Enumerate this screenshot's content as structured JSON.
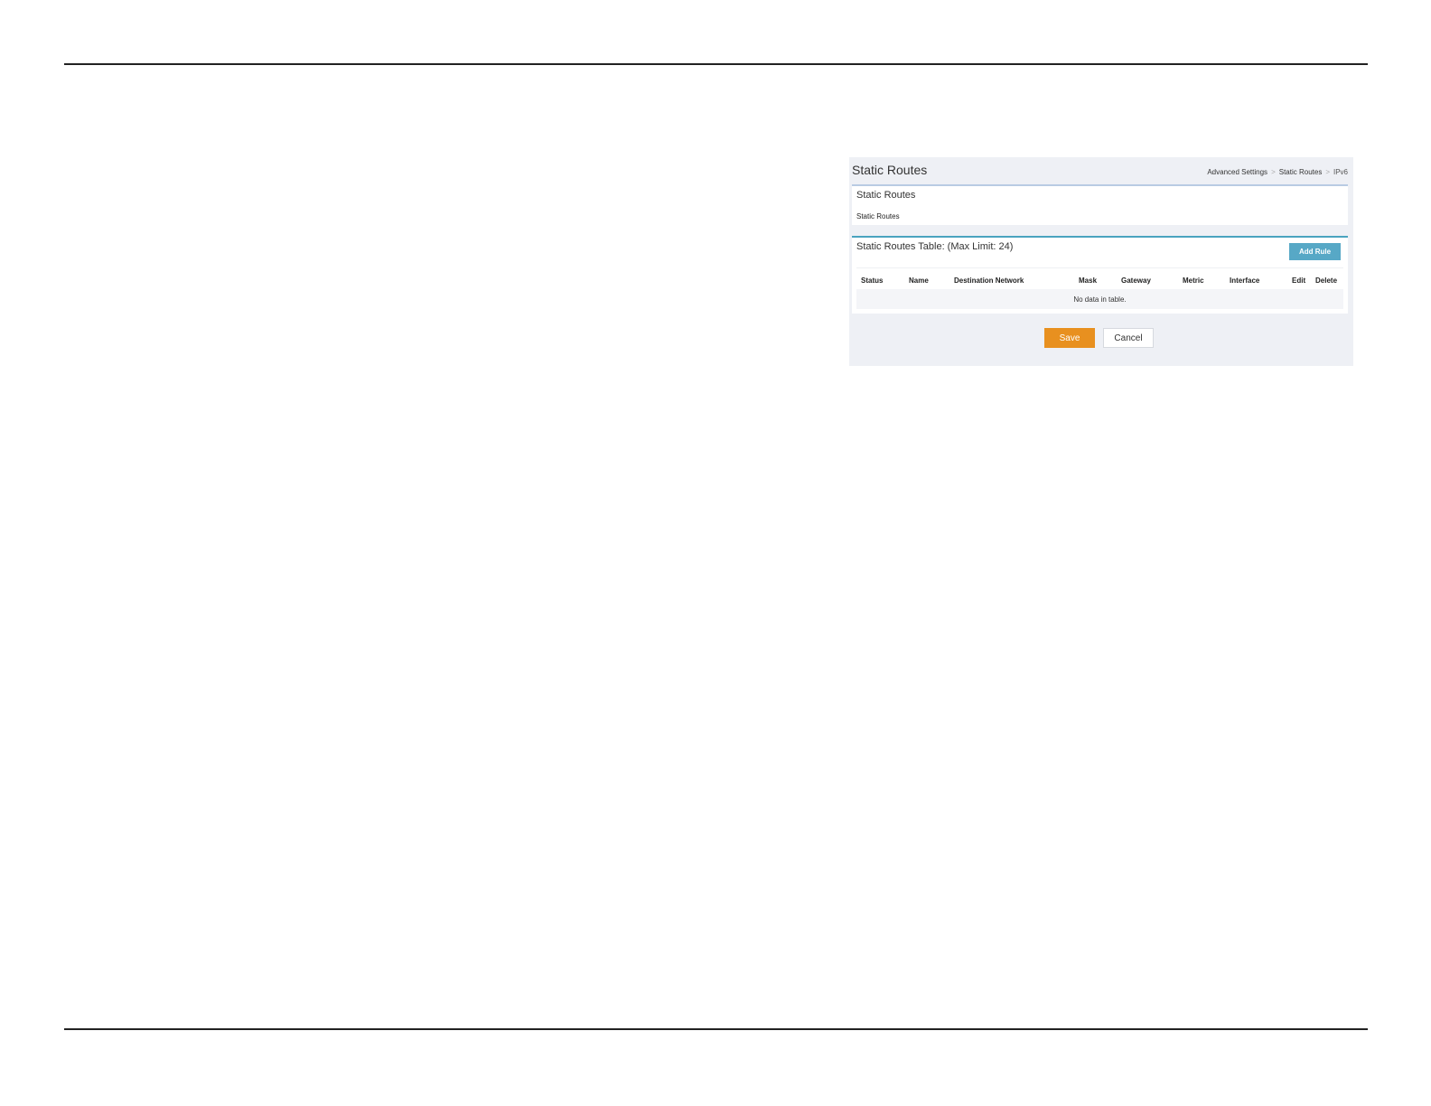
{
  "page": {
    "title": "Static Routes",
    "breadcrumb": [
      "Advanced Settings",
      "Static Routes",
      "IPv6"
    ]
  },
  "section": {
    "title": "Static Routes",
    "subtitle": "Static Routes"
  },
  "table_panel": {
    "title": "Static Routes Table: (Max Limit: 24)",
    "add_button": "Add Rule",
    "columns": [
      "Status",
      "Name",
      "Destination Network",
      "Mask",
      "Gateway",
      "Metric",
      "Interface",
      "Edit",
      "Delete"
    ],
    "empty_message": "No data in table."
  },
  "actions": {
    "save": "Save",
    "cancel": "Cancel"
  },
  "colors": {
    "save_button": "#e8901f",
    "add_button": "#57a8c6",
    "panel_accent": "#4aa3bf"
  }
}
